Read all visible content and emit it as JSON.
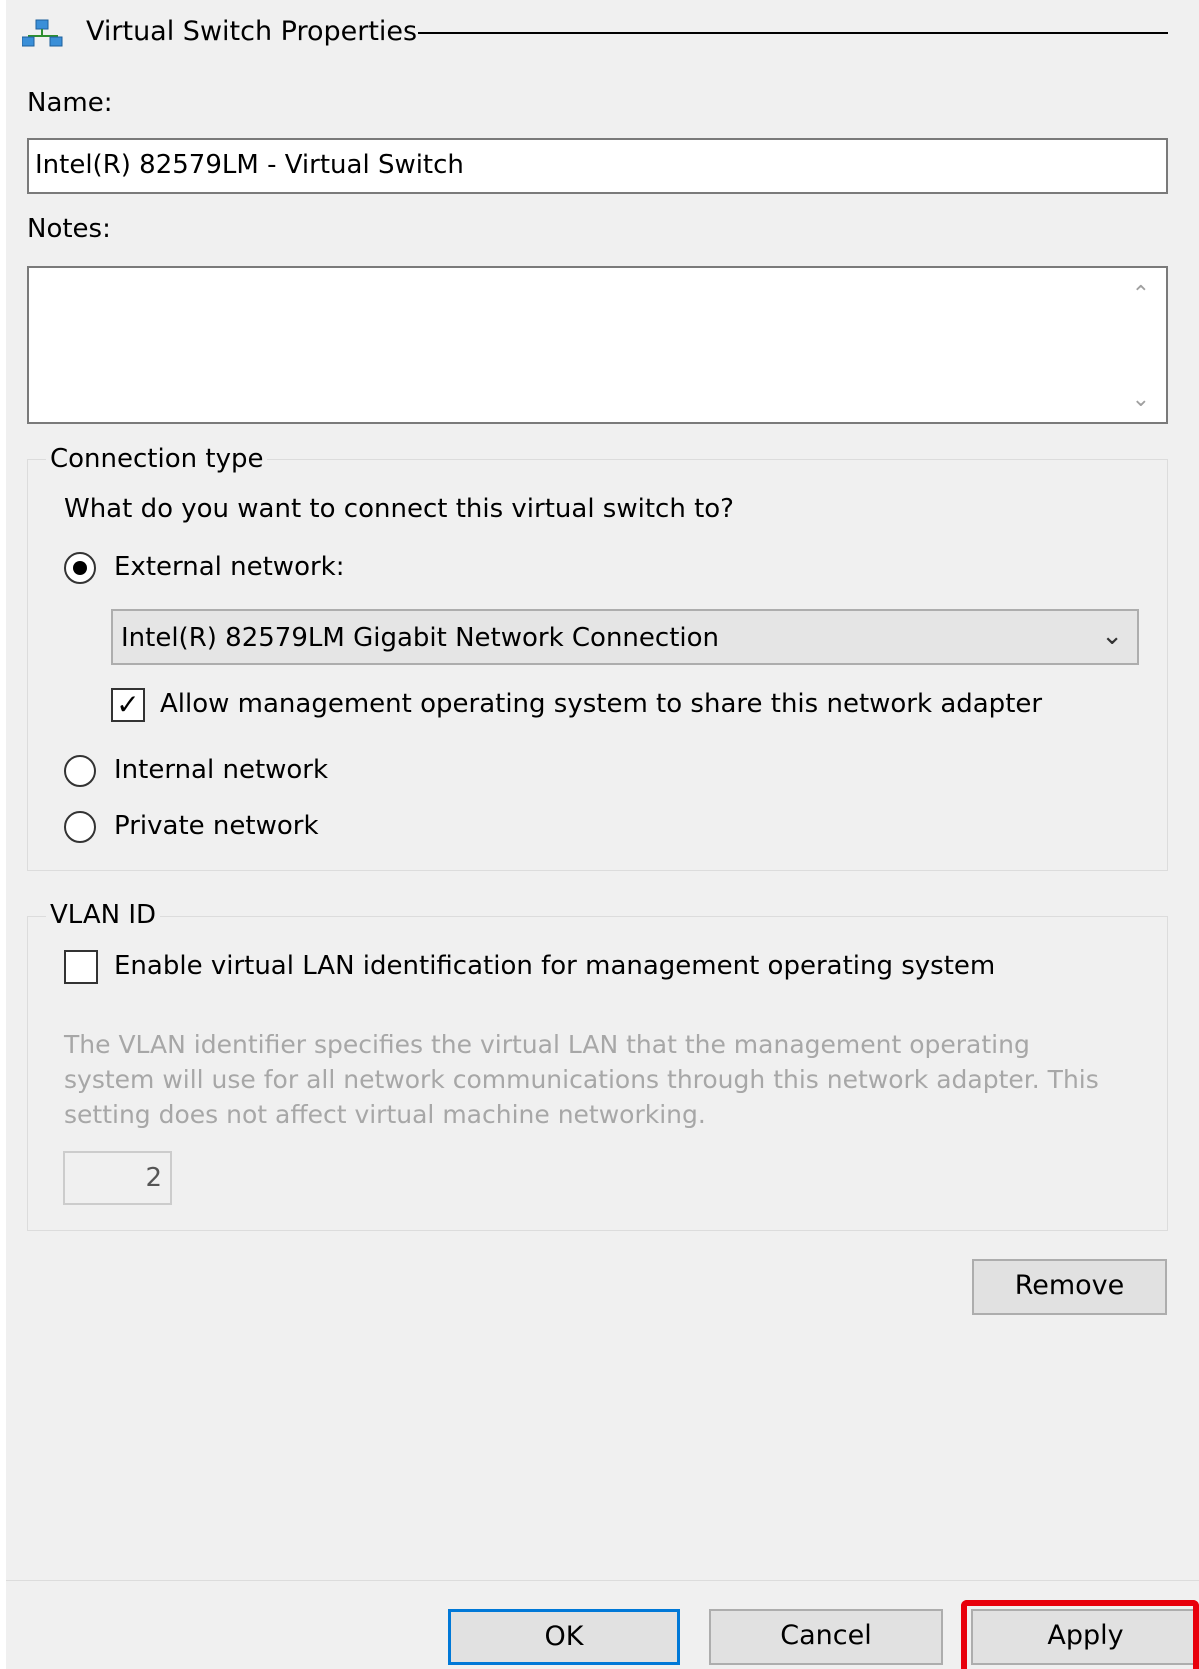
{
  "header": {
    "title": "Virtual Switch Properties",
    "icon": "network-icon"
  },
  "name": {
    "label": "Name:",
    "value": "Intel(R) 82579LM - Virtual Switch"
  },
  "notes": {
    "label": "Notes:",
    "value": ""
  },
  "connection": {
    "group_label": "Connection type",
    "question": "What do you want to connect this virtual switch to?",
    "external_label": "External network:",
    "adapter_selected": "Intel(R) 82579LM Gigabit Network Connection",
    "allow_mgmt_label": "Allow management operating system to share this network adapter",
    "internal_label": "Internal network",
    "private_label": "Private network",
    "selected": "external",
    "allow_mgmt_checked": true
  },
  "vlan": {
    "group_label": "VLAN ID",
    "enable_label": "Enable virtual LAN identification for management operating system",
    "enable_checked": false,
    "description": "The VLAN identifier specifies the virtual LAN that the management operating system will use for all network communications through this network adapter. This setting does not affect virtual machine networking.",
    "value": "2"
  },
  "buttons": {
    "remove": "Remove",
    "ok": "OK",
    "cancel": "Cancel",
    "apply": "Apply"
  },
  "colors": {
    "focus": "#0078d7",
    "highlight": "#e8000b",
    "disabled_text": "#a7a7a7"
  }
}
